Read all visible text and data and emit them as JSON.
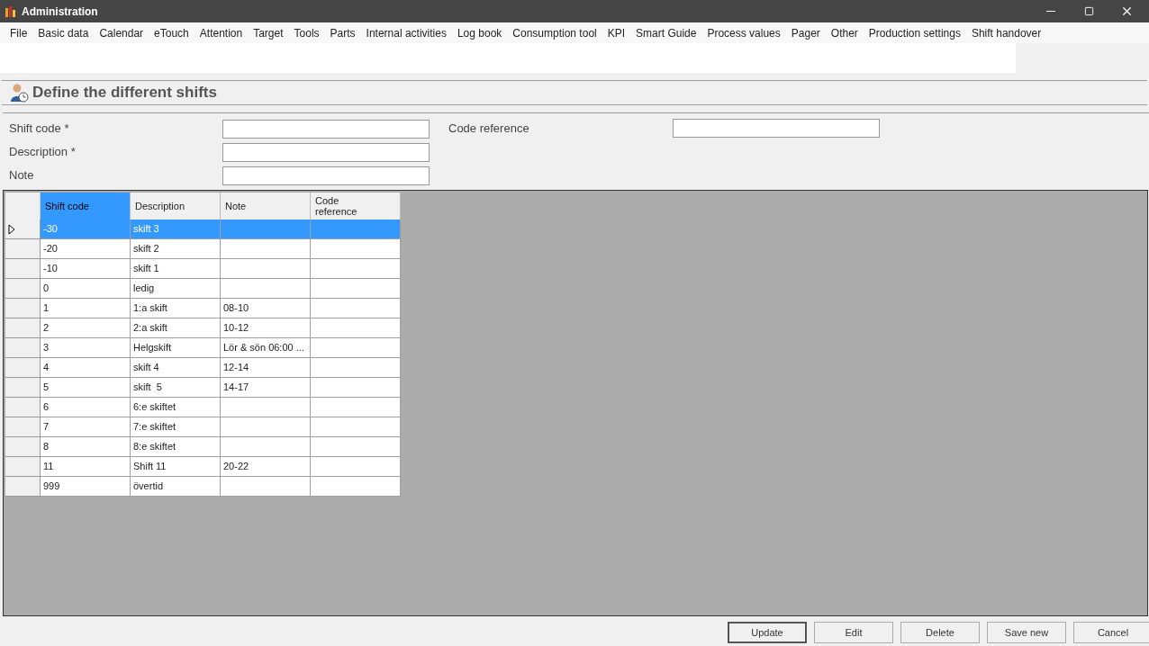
{
  "window": {
    "title": "Administration"
  },
  "menu": [
    "File",
    "Basic data",
    "Calendar",
    "eTouch",
    "Attention",
    "Target",
    "Tools",
    "Parts",
    "Internal activities",
    "Log book",
    "Consumption tool",
    "KPI",
    "Smart Guide",
    "Process values",
    "Pager",
    "Other",
    "Production settings",
    "Shift handover"
  ],
  "page_title": "Define the different shifts",
  "form": {
    "fields": [
      {
        "label": "Shift code *"
      },
      {
        "label": "Description *"
      },
      {
        "label": "Note"
      }
    ],
    "side_field": {
      "label": "Code reference"
    }
  },
  "table": {
    "columns": [
      {
        "label": "Shift code",
        "selected": true
      },
      {
        "label": "Description",
        "selected": false
      },
      {
        "label": "Note",
        "selected": false
      },
      {
        "label": "Code reference",
        "selected": false
      }
    ],
    "rows": [
      {
        "cells": [
          "-30",
          "skift 3",
          "",
          ""
        ],
        "selected": true
      },
      {
        "cells": [
          "-20",
          "skift 2",
          "",
          ""
        ],
        "selected": false
      },
      {
        "cells": [
          "-10",
          "skift 1",
          "",
          ""
        ],
        "selected": false
      },
      {
        "cells": [
          "0",
          "ledig",
          "",
          ""
        ],
        "selected": false
      },
      {
        "cells": [
          "1",
          "1:a skift",
          "08-10",
          ""
        ],
        "selected": false
      },
      {
        "cells": [
          "2",
          "2:a skift",
          "10-12",
          ""
        ],
        "selected": false
      },
      {
        "cells": [
          "3",
          "Helgskift",
          "Lör & sön 06:00 ...",
          ""
        ],
        "selected": false
      },
      {
        "cells": [
          "4",
          "skift 4",
          "12-14",
          ""
        ],
        "selected": false
      },
      {
        "cells": [
          "5",
          "skift  5",
          "14-17",
          ""
        ],
        "selected": false
      },
      {
        "cells": [
          "6",
          "6:e skiftet",
          "",
          ""
        ],
        "selected": false
      },
      {
        "cells": [
          "7",
          "7:e skiftet",
          "",
          ""
        ],
        "selected": false
      },
      {
        "cells": [
          "8",
          "8:e skiftet",
          "",
          ""
        ],
        "selected": false
      },
      {
        "cells": [
          "11",
          "Shift 11",
          "20-22",
          ""
        ],
        "selected": false
      },
      {
        "cells": [
          "999",
          "övertid",
          "",
          ""
        ],
        "selected": false
      }
    ]
  },
  "buttons": [
    "Update",
    "Edit",
    "Delete",
    "Save new",
    "Cancel"
  ]
}
